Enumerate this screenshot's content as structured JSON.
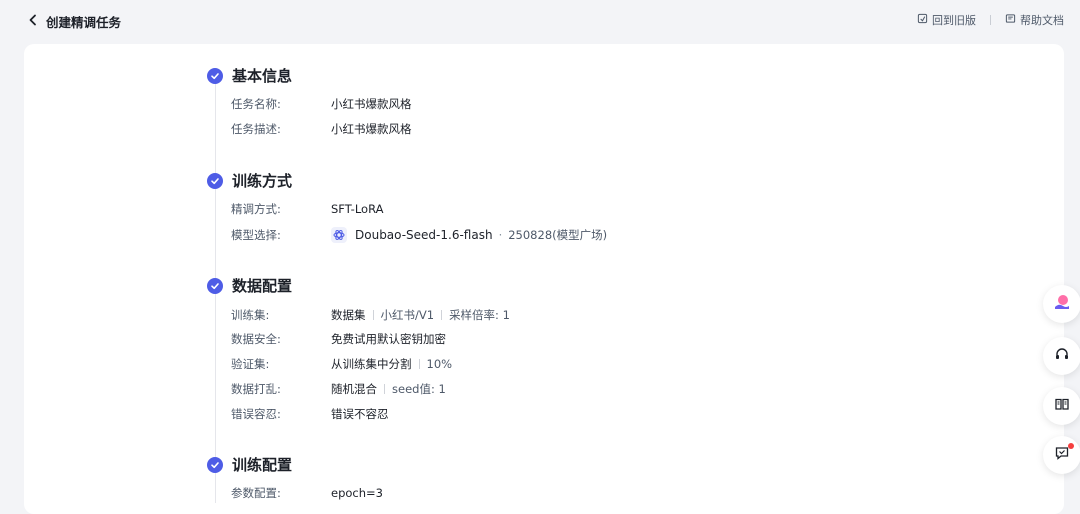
{
  "header": {
    "title": "创建精调任务",
    "back_to_old": "回到旧版",
    "help_docs": "帮助文档"
  },
  "sections": {
    "basic": {
      "title": "基本信息",
      "task_name_label": "任务名称:",
      "task_name_value": "小红书爆款风格",
      "task_desc_label": "任务描述:",
      "task_desc_value": "小红书爆款风格"
    },
    "training_method": {
      "title": "训练方式",
      "method_label": "精调方式:",
      "method_value": "SFT-LoRA",
      "model_label": "模型选择:",
      "model_name": "Doubao-Seed-1.6-flash",
      "model_version": "250828(模型广场)"
    },
    "data_config": {
      "title": "数据配置",
      "train_set_label": "训练集:",
      "train_set_type": "数据集",
      "train_set_name": "小红书/V1",
      "sample_rate": "采样倍率: 1",
      "security_label": "数据安全:",
      "security_value": "免费试用默认密钥加密",
      "val_label": "验证集:",
      "val_value": "从训练集中分割",
      "val_ratio": "10%",
      "shuffle_label": "数据打乱:",
      "shuffle_value": "随机混合",
      "seed": "seed值: 1",
      "tolerance_label": "错误容忍:",
      "tolerance_value": "错误不容忍"
    },
    "train_config": {
      "title": "训练配置",
      "param_label": "参数配置:",
      "param_value": "epoch=3"
    }
  }
}
